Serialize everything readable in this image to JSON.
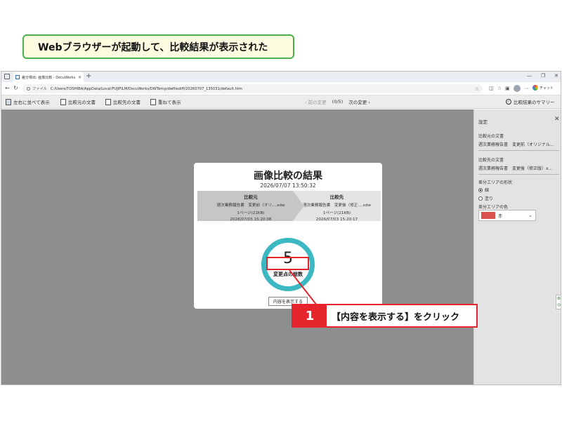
{
  "caption": "Webブラウザーが起動して、比較結果が表示された",
  "browser": {
    "tab_title": "差分検出: 画像比較 - DocuWorks",
    "url_scheme": "ファイル",
    "url": "C:/Users/TOSHIBA/AppData/Local/FUJIFILM/DocuWorks/DWTemp/dwfilediff/20260707_135031/default.htm",
    "chat_label": "チャット"
  },
  "toolbar": {
    "side_by_side": "左右に並べて表示",
    "source_doc": "比較元の文書",
    "target_doc": "比較先の文書",
    "overlay": "重ねて表示",
    "prev_change": "前の変更",
    "position": "(0/5)",
    "next_change": "次の変更",
    "summary": "比較結果のサマリー"
  },
  "settings": {
    "title": "設定",
    "source_label": "比較元の文書",
    "source_value": "週次業務報告書　変更前（オリジナル...",
    "target_label": "比較先の文書",
    "target_value": "週次業務報告書　変更後（修正版）x...",
    "shape_label": "差分エリアの形状",
    "shape_options": [
      "線",
      "塗り"
    ],
    "color_label": "差分エリアの色",
    "color_value": "赤",
    "color_swatch": "#d9534f"
  },
  "dialog": {
    "title": "画像比較の結果",
    "datetime": "2026/07/07 13:50:32",
    "source": {
      "heading": "比較元",
      "name": "週次業務報告書　変更前（オリ....xdw",
      "pages": "1ページ(21KB)",
      "date": "2026/07/03 15:20:08"
    },
    "target": {
      "heading": "比較先",
      "name": "週次業務報告書　変更後（修正....xdw",
      "pages": "1ページ(21KB)",
      "date": "2026/07/03 15:20:17"
    },
    "total_changes": "5",
    "total_label": "変更点の総数",
    "show_button": "内容を表示する",
    "ring_color": "#3bb8c2"
  },
  "callout": {
    "step": "1",
    "text": "【内容を表示する】をクリック",
    "color": "#e5242b"
  }
}
